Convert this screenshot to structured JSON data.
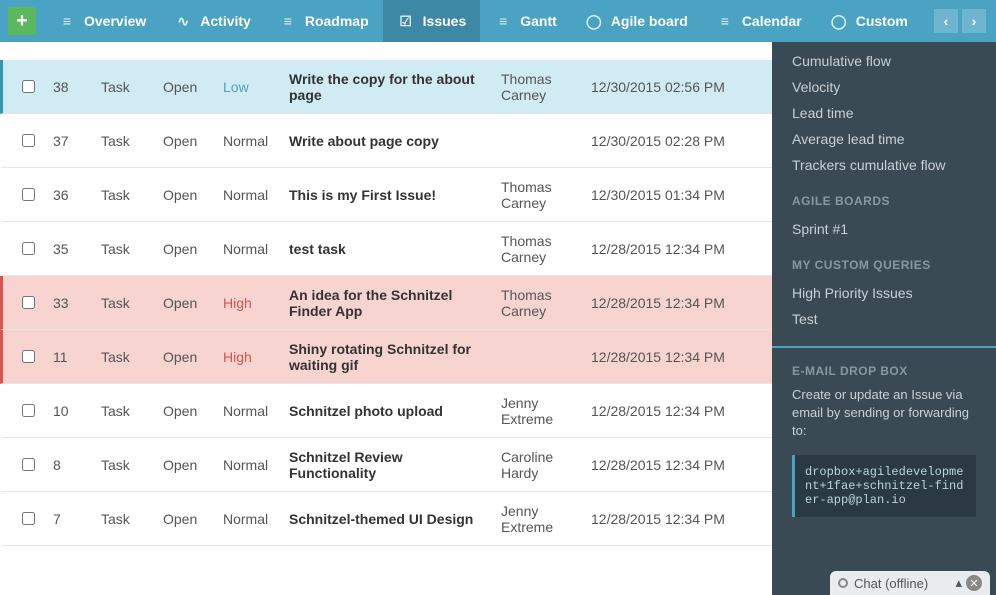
{
  "nav": {
    "add": "+",
    "items": [
      {
        "label": "Overview"
      },
      {
        "label": "Activity"
      },
      {
        "label": "Roadmap"
      },
      {
        "label": "Issues"
      },
      {
        "label": "Gantt"
      },
      {
        "label": "Agile board"
      },
      {
        "label": "Calendar"
      },
      {
        "label": "Custom"
      }
    ],
    "prev": "‹",
    "next": "›"
  },
  "issues": [
    {
      "id": "38",
      "tracker": "Task",
      "status": "Open",
      "priority": "Low",
      "priorityClass": "low",
      "subject": "Write the copy for the about page",
      "assignee": "Thomas Carney",
      "updated": "12/30/2015 02:56 PM"
    },
    {
      "id": "37",
      "tracker": "Task",
      "status": "Open",
      "priority": "Normal",
      "priorityClass": "",
      "subject": "Write about page copy",
      "assignee": "",
      "updated": "12/30/2015 02:28 PM"
    },
    {
      "id": "36",
      "tracker": "Task",
      "status": "Open",
      "priority": "Normal",
      "priorityClass": "",
      "subject": "This is my First Issue!",
      "assignee": "Thomas Carney",
      "updated": "12/30/2015 01:34 PM"
    },
    {
      "id": "35",
      "tracker": "Task",
      "status": "Open",
      "priority": "Normal",
      "priorityClass": "",
      "subject": "test task",
      "assignee": "Thomas Carney",
      "updated": "12/28/2015 12:34 PM"
    },
    {
      "id": "33",
      "tracker": "Task",
      "status": "Open",
      "priority": "High",
      "priorityClass": "high",
      "subject": "An idea for the Schnitzel Finder App",
      "assignee": "Thomas Carney",
      "updated": "12/28/2015 12:34 PM"
    },
    {
      "id": "11",
      "tracker": "Task",
      "status": "Open",
      "priority": "High",
      "priorityClass": "high",
      "subject": "Shiny rotating Schnitzel for waiting gif",
      "assignee": "",
      "updated": "12/28/2015 12:34 PM"
    },
    {
      "id": "10",
      "tracker": "Task",
      "status": "Open",
      "priority": "Normal",
      "priorityClass": "",
      "subject": "Schnitzel photo upload",
      "assignee": "Jenny Extreme",
      "updated": "12/28/2015 12:34 PM"
    },
    {
      "id": "8",
      "tracker": "Task",
      "status": "Open",
      "priority": "Normal",
      "priorityClass": "",
      "subject": "Schnitzel Review Functionality",
      "assignee": "Caroline Hardy",
      "updated": "12/28/2015 12:34 PM"
    },
    {
      "id": "7",
      "tracker": "Task",
      "status": "Open",
      "priority": "Normal",
      "priorityClass": "",
      "subject": "Schnitzel-themed UI Design",
      "assignee": "Jenny Extreme",
      "updated": "12/28/2015 12:34 PM"
    }
  ],
  "sidebar": {
    "links": [
      "Cumulative flow",
      "Velocity",
      "Lead time",
      "Average lead time",
      "Trackers cumulative flow"
    ],
    "boardsHead": "AGILE BOARDS",
    "boards": [
      "Sprint #1"
    ],
    "queriesHead": "MY CUSTOM QUERIES",
    "queries": [
      "High Priority Issues",
      "Test"
    ],
    "emailHead": "E-MAIL DROP BOX",
    "emailText": "Create or update an Issue via email by sending or forwarding to:",
    "emailAddr": "dropbox+agiledevelopment+1fae+schnitzel-finder-app@plan.io"
  },
  "chat": {
    "label": "Chat (offline)",
    "up": "▴",
    "close": "✕"
  }
}
